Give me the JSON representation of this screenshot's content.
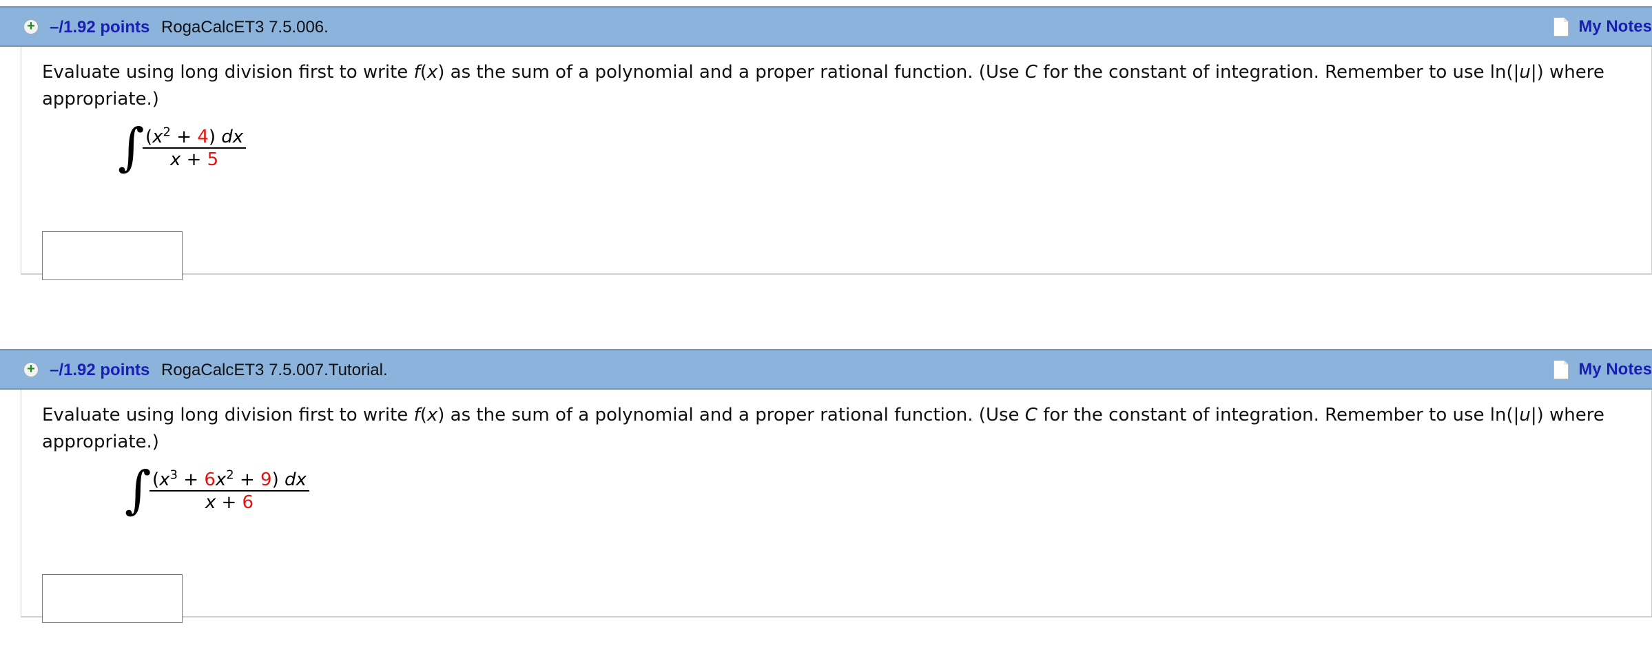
{
  "questions": [
    {
      "expand_symbol": "+",
      "points": "–/1.92 points",
      "ref": "RogaCalcET3 7.5.006.",
      "notes_label": "My Notes",
      "text_a": "Evaluate using long division first to write ",
      "text_fx_f": "f",
      "text_fx_rest": "(",
      "text_fx_x": "x",
      "text_fx_close": ")",
      "text_b": " as the sum of a polynomial and a proper rational function. (Use ",
      "text_c": "C",
      "text_d": " for the constant of integration. Remember to use ln(|",
      "text_u": "u",
      "text_e": "|) where appropriate.)",
      "integral_symbol": "∫",
      "numerator": {
        "open": "(",
        "var": "x",
        "power": "2",
        "plus": " + ",
        "const": "4",
        "close": ") ",
        "dx": "dx"
      },
      "denominator": {
        "var": "x",
        "plus": " + ",
        "const": "5"
      },
      "answer_value": ""
    },
    {
      "expand_symbol": "+",
      "points": "–/1.92 points",
      "ref": "RogaCalcET3 7.5.007.Tutorial.",
      "notes_label": "My Notes",
      "text_a": "Evaluate using long division first to write ",
      "text_fx_f": "f",
      "text_fx_rest": "(",
      "text_fx_x": "x",
      "text_fx_close": ")",
      "text_b": " as the sum of a polynomial and a proper rational function. (Use ",
      "text_c": "C",
      "text_d": " for the constant of integration. Remember to use ln(|",
      "text_u": "u",
      "text_e": "|) where appropriate.)",
      "integral_symbol": "∫",
      "numerator": {
        "open": "(",
        "var1": "x",
        "power1": "3",
        "plus1": " + ",
        "coef": "6",
        "var2": "x",
        "power2": "2",
        "plus2": " + ",
        "const": "9",
        "close": ") ",
        "dx": "dx"
      },
      "denominator": {
        "var": "x",
        "plus": " + ",
        "const": "6"
      },
      "answer_value": ""
    }
  ]
}
